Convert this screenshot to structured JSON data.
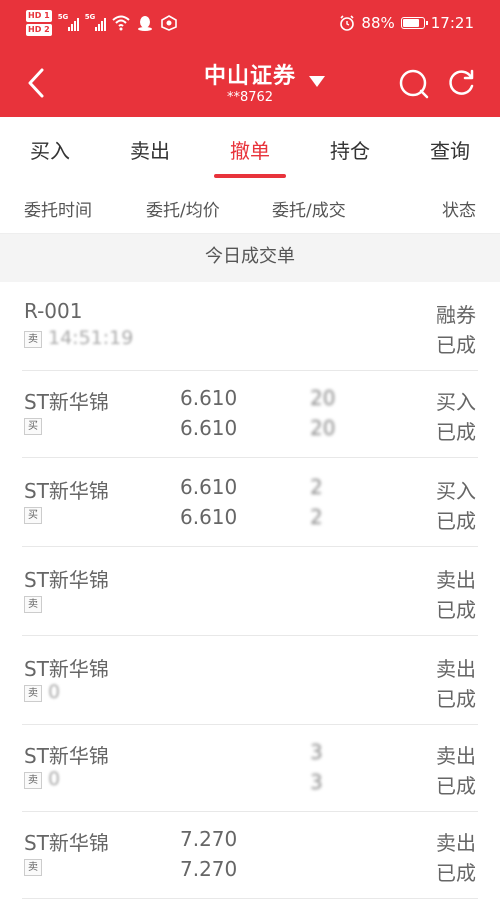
{
  "status_bar": {
    "hd1": "HD 1",
    "hd2": "HD 2",
    "sig1_tag": "5G",
    "sig2_tag": "5G",
    "battery": "88%",
    "battery_level": 0.88,
    "time": "17:21"
  },
  "header": {
    "title": "中山证券",
    "account": "**8762"
  },
  "tabs": [
    {
      "label": "买入"
    },
    {
      "label": "卖出"
    },
    {
      "label": "撤单"
    },
    {
      "label": "持仓"
    },
    {
      "label": "查询"
    }
  ],
  "active_tab": "撤单",
  "columns": [
    "委托时间",
    "委托/均价",
    "委托/成交",
    "状态"
  ],
  "section_title": "今日成交单",
  "rows": [
    {
      "name": "R-001",
      "side": "卖",
      "time": "14:51:19",
      "price1": "",
      "price2": "",
      "qty1": "",
      "qty2": "",
      "status1": "融券",
      "status2": "已成"
    },
    {
      "name": "ST新华锦",
      "side": "买",
      "time": "",
      "price1": "6.610",
      "price2": "6.610",
      "qty1": "20",
      "qty2": "20",
      "status1": "买入",
      "status2": "已成"
    },
    {
      "name": "ST新华锦",
      "side": "买",
      "time": "",
      "price1": "6.610",
      "price2": "6.610",
      "qty1": "2",
      "qty2": "2",
      "status1": "买入",
      "status2": "已成"
    },
    {
      "name": "ST新华锦",
      "side": "卖",
      "time": "",
      "price1": "",
      "price2": "",
      "qty1": "",
      "qty2": "",
      "status1": "卖出",
      "status2": "已成"
    },
    {
      "name": "ST新华锦",
      "side": "卖",
      "time": "0",
      "price1": "",
      "price2": "",
      "qty1": "",
      "qty2": "",
      "status1": "卖出",
      "status2": "已成"
    },
    {
      "name": "ST新华锦",
      "side": "卖",
      "time": "0",
      "price1": "",
      "price2": "",
      "qty1": "3",
      "qty2": "3",
      "status1": "卖出",
      "status2": "已成"
    },
    {
      "name": "ST新华锦",
      "side": "卖",
      "time": "",
      "price1": "7.270",
      "price2": "7.270",
      "qty1": "",
      "qty2": "",
      "status1": "卖出",
      "status2": "已成"
    }
  ],
  "colors": {
    "brand_red": "#e8333b",
    "text_gray": "#666666"
  }
}
